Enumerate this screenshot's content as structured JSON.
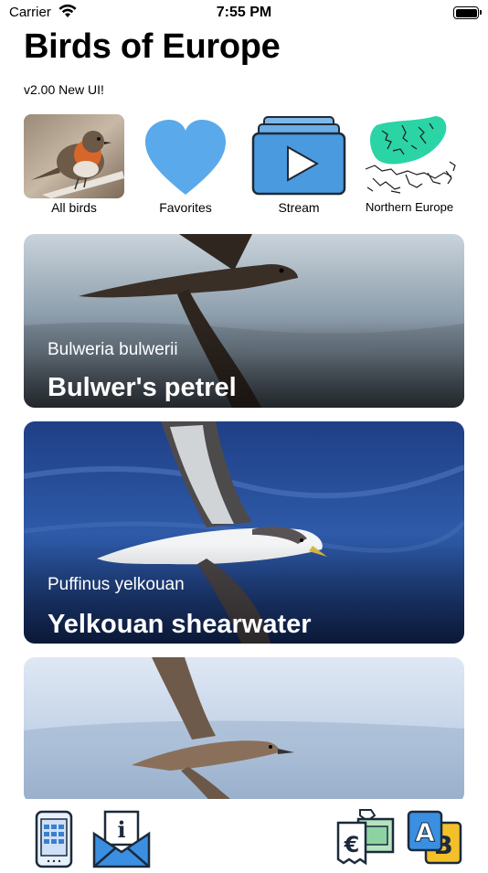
{
  "status_bar": {
    "carrier": "Carrier",
    "time": "7:55 PM"
  },
  "header": {
    "title": "Birds of Europe",
    "version": "v2.00 New UI!"
  },
  "shortcuts": [
    {
      "label": "All birds",
      "icon": "robin-photo"
    },
    {
      "label": "Favorites",
      "icon": "heart-icon"
    },
    {
      "label": "Stream",
      "icon": "play-stack-icon"
    },
    {
      "label": "Northern Europe",
      "icon": "europe-map-icon"
    }
  ],
  "cards": [
    {
      "scientific": "Bulweria bulwerii",
      "common": "Bulwer's petrel"
    },
    {
      "scientific": "Puffinus yelkouan",
      "common": "Yelkouan shearwater"
    },
    {
      "scientific": "",
      "common": ""
    }
  ],
  "toolbar": {
    "items": [
      "phone-keypad-icon",
      "mail-info-icon",
      "currency-exchange-icon",
      "translate-icon"
    ]
  }
}
